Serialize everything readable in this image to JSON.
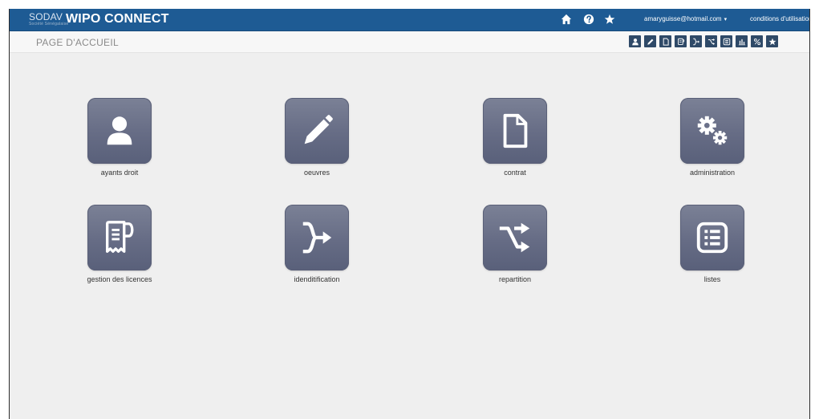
{
  "header": {
    "logo_text": "SODAV",
    "logo_subtext": "Société Sénégalaise",
    "app_title": "WIPO CONNECT",
    "user_email": "amaryguisse@hotmail.com",
    "user_caret": "▾",
    "terms_label": "conditions d'utilisation",
    "icons": [
      "home-icon",
      "help-icon",
      "star-icon"
    ]
  },
  "subheader": {
    "page_title": "PAGE D'ACCUEIL",
    "quick_icons": [
      "user-icon",
      "pencil-icon",
      "file-icon",
      "license-icon",
      "identification-icon",
      "repartition-icon",
      "list-icon",
      "bar-chart-icon",
      "percent-icon",
      "star-icon"
    ]
  },
  "tiles": [
    {
      "label": "ayants droit",
      "icon": "user-icon"
    },
    {
      "label": "oeuvres",
      "icon": "pencil-icon"
    },
    {
      "label": "contrat",
      "icon": "file-icon"
    },
    {
      "label": "administration",
      "icon": "gears-icon"
    },
    {
      "label": "gestion des licences",
      "icon": "license-icon"
    },
    {
      "label": "idenditification",
      "icon": "identification-icon"
    },
    {
      "label": "repartition",
      "icon": "repartition-icon"
    },
    {
      "label": "listes",
      "icon": "list-icon"
    }
  ],
  "colors": {
    "topbar": "#1e5b94",
    "tile": "#6b7189",
    "quick_button": "#2f4a68",
    "background": "#efefef"
  }
}
